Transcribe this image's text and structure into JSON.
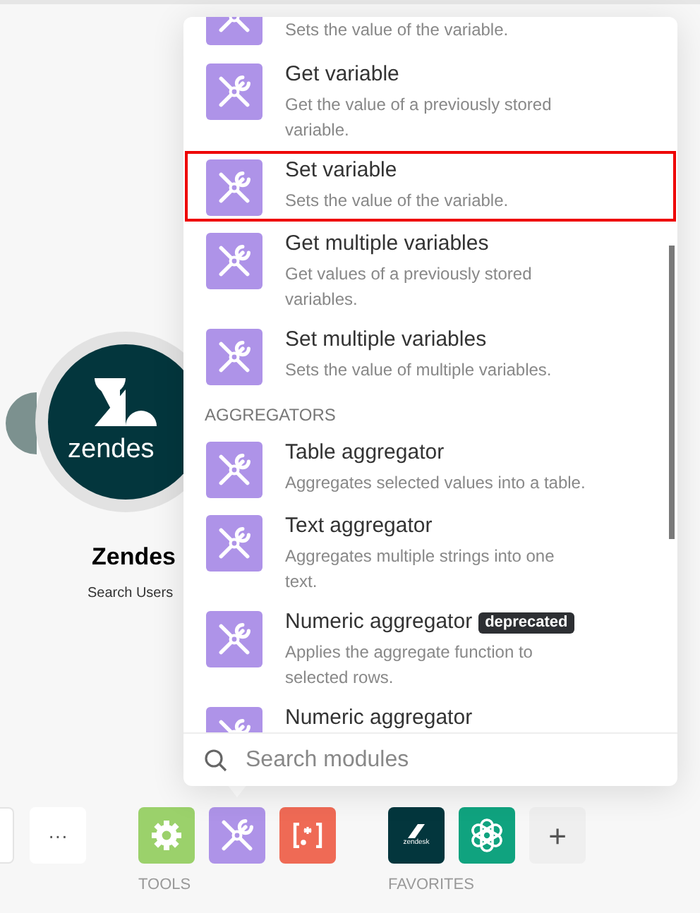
{
  "node": {
    "logo_text": "zendes",
    "title": "Zendes",
    "subtitle": "Search Users"
  },
  "popup": {
    "items": [
      {
        "kind": "module",
        "description": "Sets the value of the variable.",
        "selected": false
      },
      {
        "kind": "module",
        "title": "Get variable",
        "description": "Get the value of a previously stored variable.",
        "selected": false
      },
      {
        "kind": "module",
        "title": "Set variable",
        "description": "Sets the value of the variable.",
        "selected": true
      },
      {
        "kind": "module",
        "title": "Get multiple variables",
        "description": "Get values of a previously stored variables.",
        "selected": false
      },
      {
        "kind": "module",
        "title": "Set multiple variables",
        "description": "Sets the value of multiple variables.",
        "selected": false
      },
      {
        "kind": "header",
        "title": "AGGREGATORS"
      },
      {
        "kind": "module",
        "title": "Table aggregator",
        "description": "Aggregates selected values into a table.",
        "selected": false
      },
      {
        "kind": "module",
        "title": "Text aggregator",
        "description": "Aggregates multiple strings into one text.",
        "selected": false
      },
      {
        "kind": "module",
        "title": "Numeric aggregator",
        "badge": "deprecated",
        "description": "Applies the aggregate function to selected rows.",
        "selected": false
      },
      {
        "kind": "module",
        "title": "Numeric aggregator",
        "selected": false
      }
    ],
    "search": {
      "placeholder": "Search modules"
    }
  },
  "toolbar": {
    "more": "···",
    "tools": {
      "label": "TOOLS",
      "items": [
        {
          "kind": "gear"
        },
        {
          "kind": "tools"
        },
        {
          "kind": "regex"
        }
      ]
    },
    "favorites": {
      "label": "FAVORITES",
      "items": [
        {
          "kind": "zendesk",
          "text": "zendesk"
        },
        {
          "kind": "openai"
        }
      ],
      "add": "+"
    }
  }
}
